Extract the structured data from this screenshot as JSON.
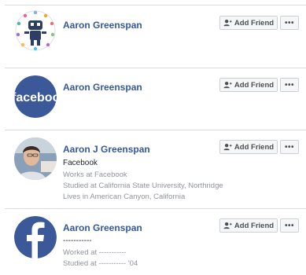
{
  "results": [
    {
      "name": "Aaron Greenspan",
      "avatar": "robot-illustration-avatar",
      "details": [],
      "add_friend_label": "Add Friend",
      "more_label": "•••"
    },
    {
      "name": "Aaron Greenspan",
      "avatar": "facebook-wordmark-avatar",
      "avatar_text": "faceboo",
      "details": [],
      "add_friend_label": "Add Friend",
      "more_label": "•••"
    },
    {
      "name": "Aaron J Greenspan",
      "avatar": "person-photo-avatar",
      "details": [
        "Facebook",
        "Works at Facebook",
        "Studied at California State University, Northridge",
        "Lives in American Canyon, California"
      ],
      "add_friend_label": "Add Friend",
      "more_label": "•••"
    },
    {
      "name": "Aaron Greenspan",
      "avatar": "facebook-f-logo-avatar",
      "details": [
        "-----------",
        "Worked at -----------",
        "Studied at ----------- '04"
      ],
      "add_friend_label": "Add Friend",
      "more_label": "•••"
    }
  ],
  "colors": {
    "name_link": "#365899",
    "facebook_blue": "#3b5998",
    "secondary_text": "#90949c",
    "button_bg": "#f5f6f7",
    "button_border": "#ccd0d5",
    "divider": "#dadde1"
  }
}
